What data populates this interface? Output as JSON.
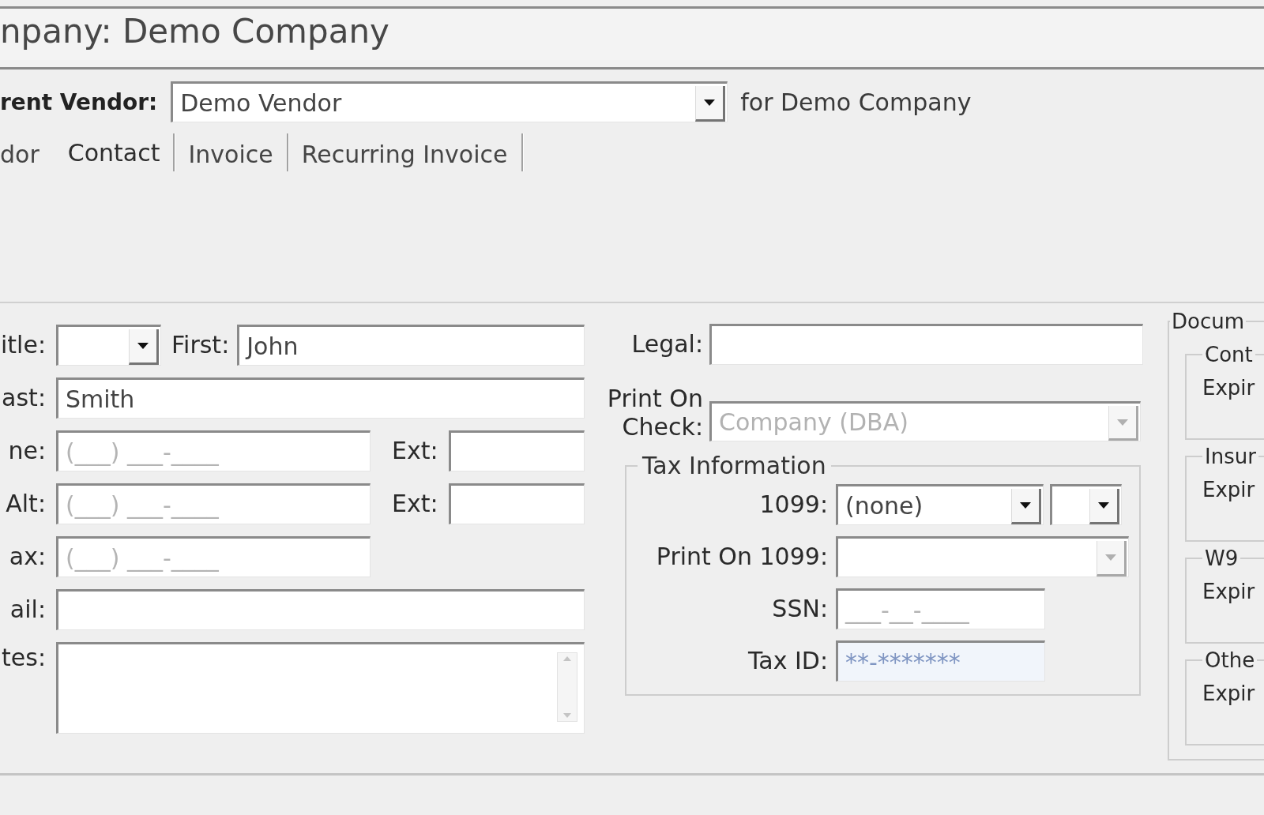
{
  "header": {
    "title": "npany: Demo Company"
  },
  "vendor_bar": {
    "label": "rent Vendor:",
    "vendor_select": {
      "value": "Demo Vendor",
      "disabled": false
    },
    "note": "for Demo Company"
  },
  "tabs": [
    {
      "label": "dor",
      "selected": false
    },
    {
      "label": "Contact",
      "selected": true
    },
    {
      "label": "Invoice",
      "selected": false
    },
    {
      "label": "Recurring Invoice",
      "selected": false
    }
  ],
  "contact": {
    "title": {
      "label": "itle:",
      "disabled": false
    },
    "first": {
      "label": "First:",
      "value": "John"
    },
    "last": {
      "label": "ast:",
      "value": "Smith"
    },
    "phone": {
      "label": "ne:",
      "placeholder": "(___) ___-____",
      "ext_label": "Ext:"
    },
    "alt_phone": {
      "label": "Alt:",
      "placeholder": "(___) ___-____",
      "ext_label": "Ext:"
    },
    "fax": {
      "label": "ax:",
      "placeholder": "(___) ___-____"
    },
    "email": {
      "label": "ail:"
    },
    "notes": {
      "label": "tes:"
    }
  },
  "legal": {
    "label": "Legal:"
  },
  "print_on_check": {
    "label": "Print On Check:",
    "value": "Company (DBA)",
    "disabled": true
  },
  "tax_information": {
    "title": "Tax Information",
    "form_1099": {
      "label": "1099:",
      "value": "(none)",
      "disabled": false,
      "extra_select": {
        "disabled": false
      }
    },
    "print_on_1099": {
      "label": "Print On 1099:",
      "disabled": true
    },
    "ssn": {
      "label": "SSN:",
      "placeholder": "___-__-____"
    },
    "tax_id": {
      "label": "Tax ID:",
      "placeholder": "**-*******",
      "focused": true
    }
  },
  "documents": {
    "title": "Docum",
    "groups": [
      {
        "title": "Cont",
        "field_label": "Expir"
      },
      {
        "title": "Insur",
        "field_label": "Expir"
      },
      {
        "title": "W9",
        "field_label": "Expir"
      },
      {
        "title": "Othe",
        "field_label": "Expir"
      }
    ]
  }
}
